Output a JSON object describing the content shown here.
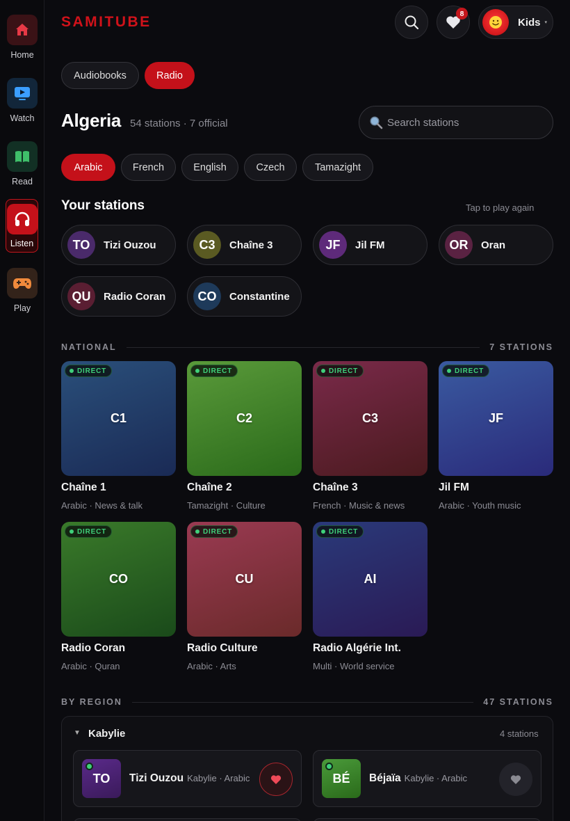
{
  "sidebar": {
    "items": [
      {
        "label": "Home",
        "icon": "home-icon",
        "color": "#e63946",
        "bg": "#3a1216"
      },
      {
        "label": "Watch",
        "icon": "tv-icon",
        "color": "#3b9eff",
        "bg": "#12263a"
      },
      {
        "label": "Read",
        "icon": "book-icon",
        "color": "#3fbf6a",
        "bg": "#123024"
      },
      {
        "label": "Listen",
        "icon": "headphones-icon",
        "color": "#ffffff",
        "bg": "#c4111a",
        "active": true
      },
      {
        "label": "Play",
        "icon": "gamepad-icon",
        "color": "#f08a3c",
        "bg": "#33231a"
      }
    ]
  },
  "header": {
    "logo": "SAMITUBE",
    "favorites_count": "8",
    "profile_name": "Kids",
    "profile_caret": "▾"
  },
  "tabs": [
    {
      "label": "Audiobooks",
      "active": false
    },
    {
      "label": "Radio",
      "active": true
    }
  ],
  "page": {
    "country": "Algeria",
    "meta": "54 stations · 7 official",
    "search_placeholder": "Search stations"
  },
  "languages": [
    {
      "label": "Arabic",
      "active": true
    },
    {
      "label": "French",
      "active": false
    },
    {
      "label": "English",
      "active": false
    },
    {
      "label": "Czech",
      "active": false
    },
    {
      "label": "Tamazight",
      "active": false
    }
  ],
  "your_stations": {
    "title": "Your stations",
    "hint": "Tap to play again",
    "items": [
      {
        "abbr": "TO",
        "name": "Tizi Ouzou",
        "color": "#4a2a6a"
      },
      {
        "abbr": "C3",
        "name": "Chaîne 3",
        "color": "#5a5a22"
      },
      {
        "abbr": "JF",
        "name": "Jil FM",
        "color": "#5e2a7a"
      },
      {
        "abbr": "OR",
        "name": "Oran",
        "color": "#5a2242"
      },
      {
        "abbr": "QU",
        "name": "Radio Coran",
        "color": "#5a1e32"
      },
      {
        "abbr": "CO",
        "name": "Constantine",
        "color": "#1e3a5a"
      }
    ]
  },
  "national": {
    "label": "NATIONAL",
    "count": "7 STATIONS",
    "live_label": "DIRECT",
    "stations": [
      {
        "abbr": "C1",
        "name": "Chaîne 1",
        "sub": "Arabic · News & talk",
        "from": "#2a4f7a",
        "to": "#1a2a55"
      },
      {
        "abbr": "C2",
        "name": "Chaîne 2",
        "sub": "Tamazight · Culture",
        "from": "#5a9a3a",
        "to": "#2a6a1a"
      },
      {
        "abbr": "C3",
        "name": "Chaîne 3",
        "sub": "French · Music & news",
        "from": "#7a2a4a",
        "to": "#4a1a1e"
      },
      {
        "abbr": "JF",
        "name": "Jil FM",
        "sub": "Arabic · Youth music",
        "from": "#3a5aa0",
        "to": "#2a2a7a"
      },
      {
        "abbr": "CO",
        "name": "Radio Coran",
        "sub": "Arabic · Quran",
        "from": "#3a7a2a",
        "to": "#1a4a1a"
      },
      {
        "abbr": "CU",
        "name": "Radio Culture",
        "sub": "Arabic · Arts",
        "from": "#9a3a52",
        "to": "#6a2a2a"
      },
      {
        "abbr": "AI",
        "name": "Radio Algérie Int.",
        "sub": "Multi · World service",
        "from": "#2a3a7a",
        "to": "#2a1a55"
      }
    ]
  },
  "region": {
    "label": "BY REGION",
    "count": "47 STATIONS",
    "group": {
      "caret": "▼",
      "name": "Kabylie",
      "count": "4 stations",
      "stations": [
        {
          "abbr": "TO",
          "name": "Tizi Ouzou",
          "sub": "Kabylie · Arabic",
          "from": "#5a2a8a",
          "to": "#3a1a5a",
          "favorite": true
        },
        {
          "abbr": "BÉ",
          "name": "Béjaïa",
          "sub": "Kabylie · Arabic",
          "from": "#4a9a3a",
          "to": "#2a6a1a",
          "favorite": false
        }
      ]
    }
  }
}
